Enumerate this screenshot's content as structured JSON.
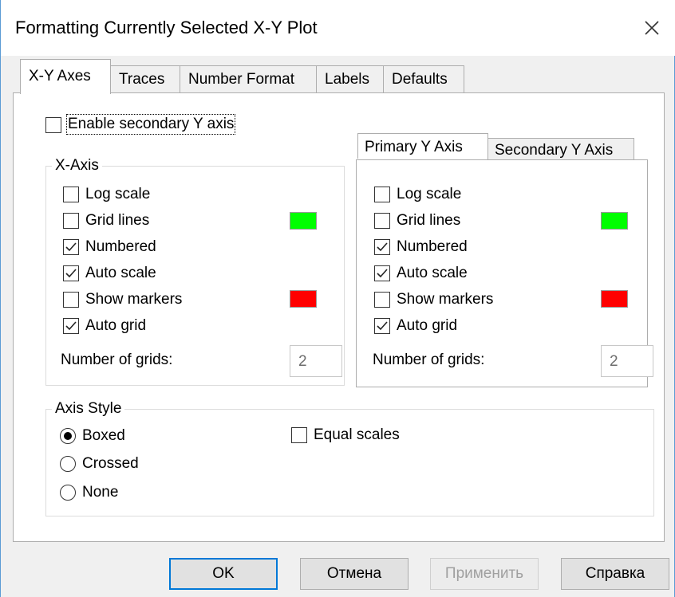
{
  "window": {
    "title": "Formatting Currently Selected X-Y Plot"
  },
  "tabs": [
    "X-Y Axes",
    "Traces",
    "Number Format",
    "Labels",
    "Defaults"
  ],
  "secondary_axis_checkbox": {
    "label": "Enable secondary Y axis",
    "checked": false
  },
  "x_axis": {
    "legend": "X-Axis",
    "options": [
      {
        "label": "Log scale",
        "checked": false
      },
      {
        "label": "Grid lines",
        "checked": false
      },
      {
        "label": "Numbered",
        "checked": true
      },
      {
        "label": "Auto scale",
        "checked": true
      },
      {
        "label": "Show markers",
        "checked": false
      },
      {
        "label": "Auto grid",
        "checked": true
      }
    ],
    "grid_color": "#00ff00",
    "marker_color": "#ff0000",
    "num_grids_label": "Number of grids:",
    "num_grids_value": "2"
  },
  "y_axis_tabs": [
    "Primary Y Axis",
    "Secondary Y Axis"
  ],
  "y_axis": {
    "options": [
      {
        "label": "Log scale",
        "checked": false
      },
      {
        "label": "Grid lines",
        "checked": false
      },
      {
        "label": "Numbered",
        "checked": true
      },
      {
        "label": "Auto scale",
        "checked": true
      },
      {
        "label": "Show markers",
        "checked": false
      },
      {
        "label": "Auto grid",
        "checked": true
      }
    ],
    "grid_color": "#00ff00",
    "marker_color": "#ff0000",
    "num_grids_label": "Number of grids:",
    "num_grids_value": "2"
  },
  "axis_style": {
    "legend": "Axis Style",
    "options": [
      {
        "label": "Boxed",
        "selected": true
      },
      {
        "label": "Crossed",
        "selected": false
      },
      {
        "label": "None",
        "selected": false
      }
    ],
    "equal_scales": {
      "label": "Equal scales",
      "checked": false
    }
  },
  "buttons": {
    "ok": "OK",
    "cancel": "Отмена",
    "apply": "Применить",
    "help": "Справка"
  }
}
